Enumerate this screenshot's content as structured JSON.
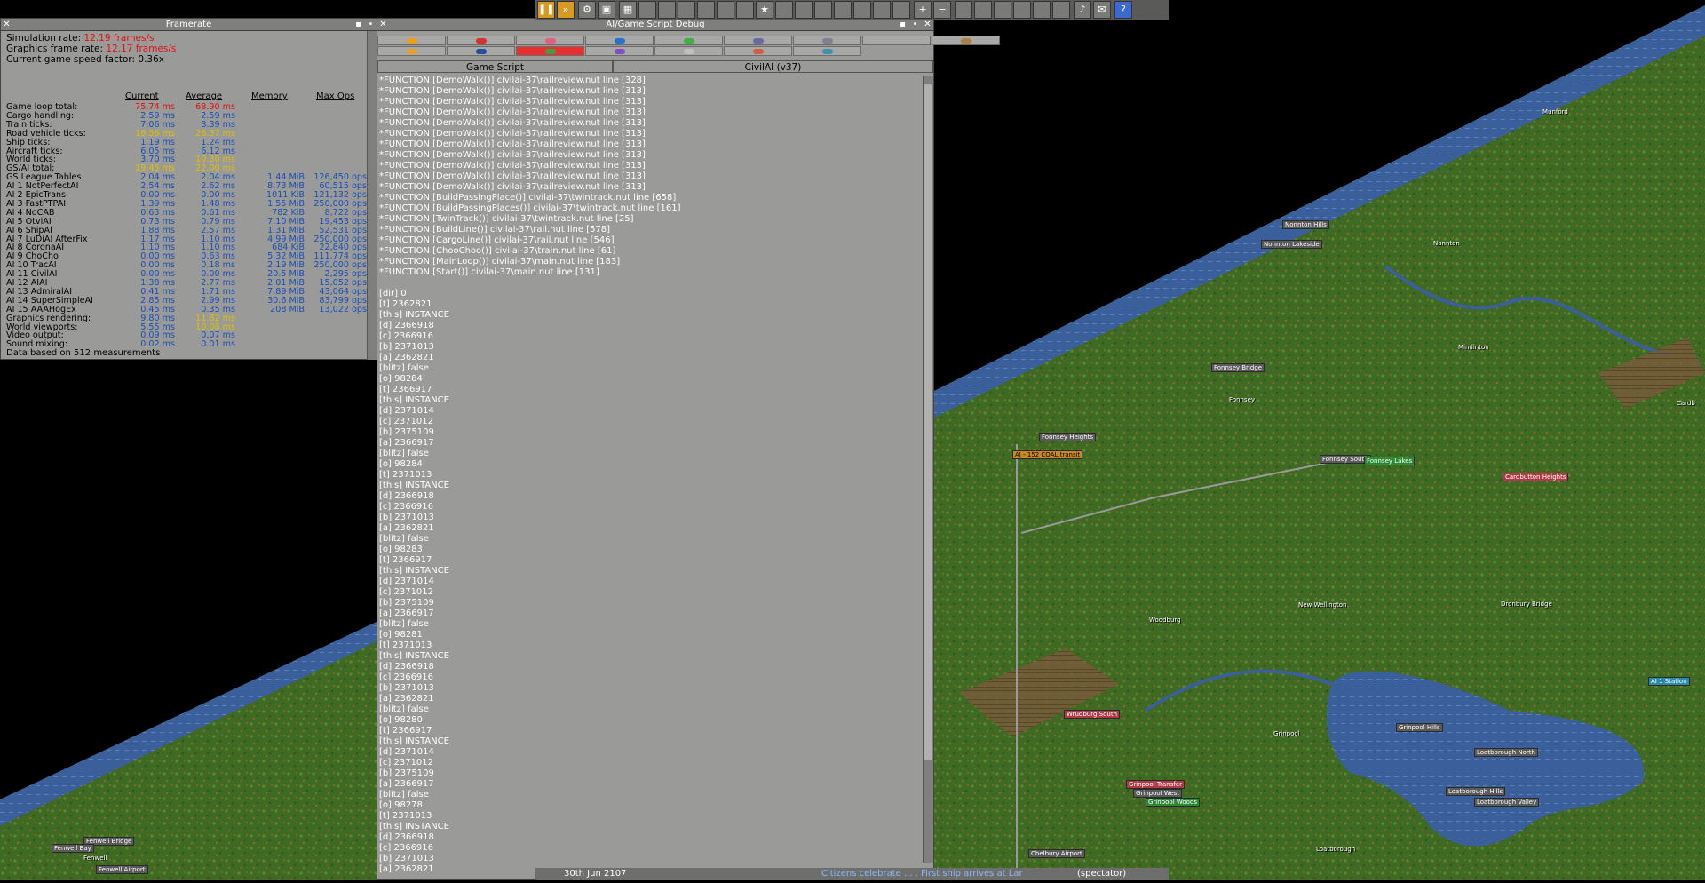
{
  "framerate": {
    "title": "Framerate",
    "sim_rate_label": "Simulation rate: ",
    "sim_rate_value": "12.19 frames/s",
    "gfx_rate_label": "Graphics frame rate: ",
    "gfx_rate_value": "12.17 frames/s",
    "speed_factor": "Current game speed factor: 0.36x",
    "headers": [
      "Current",
      "Average",
      "Memory",
      "Max Ops"
    ],
    "rows": [
      {
        "label": "Game loop total:",
        "cur": "75.74 ms",
        "avg": "68.90 ms",
        "mem": "",
        "ops": "",
        "level": "bad"
      },
      {
        "label": " Cargo handling:",
        "cur": "2.59 ms",
        "avg": "2.59 ms",
        "mem": "",
        "ops": "",
        "level": ""
      },
      {
        "label": " Train ticks:",
        "cur": "7.06 ms",
        "avg": "8.39 ms",
        "mem": "",
        "ops": "",
        "level": ""
      },
      {
        "label": " Road vehicle ticks:",
        "cur": "18.56 ms",
        "avg": "26.37 ms",
        "mem": "",
        "ops": "",
        "level": "warn"
      },
      {
        "label": " Ship ticks:",
        "cur": "1.19 ms",
        "avg": "1.24 ms",
        "mem": "",
        "ops": "",
        "level": ""
      },
      {
        "label": " Aircraft ticks:",
        "cur": "6.05 ms",
        "avg": "6.12 ms",
        "mem": "",
        "ops": "",
        "level": ""
      },
      {
        "label": " World ticks:",
        "cur": "3.70 ms",
        "avg": "10.30 ms",
        "mem": "",
        "ops": "",
        "level": "warnavg"
      },
      {
        "label": " GS/AI total:",
        "cur": "19.45 ms",
        "avg": "22.00 ms",
        "mem": "",
        "ops": "",
        "level": "warn"
      },
      {
        "label": "  GS League Tables",
        "cur": "2.04 ms",
        "avg": "2.04 ms",
        "mem": "1.44 MiB",
        "ops": "126,450 ops",
        "level": ""
      },
      {
        "label": "  AI 1 NotPerfectAI",
        "cur": "2.54 ms",
        "avg": "2.62 ms",
        "mem": "8.73 MiB",
        "ops": "60,515 ops",
        "level": ""
      },
      {
        "label": "  AI 2 EpicTrans",
        "cur": "0.00 ms",
        "avg": "0.00 ms",
        "mem": "1011 KiB",
        "ops": "121,132 ops",
        "level": ""
      },
      {
        "label": "  AI 3 FastPTPAI",
        "cur": "1.39 ms",
        "avg": "1.48 ms",
        "mem": "1.55 MiB",
        "ops": "250,000 ops",
        "level": ""
      },
      {
        "label": "  AI 4 NoCAB",
        "cur": "0.63 ms",
        "avg": "0.61 ms",
        "mem": "782 KiB",
        "ops": "8,722 ops",
        "level": ""
      },
      {
        "label": "  AI 5 OtviAI",
        "cur": "0.73 ms",
        "avg": "0.79 ms",
        "mem": "7.10 MiB",
        "ops": "19,453 ops",
        "level": ""
      },
      {
        "label": "  AI 6 ShipAI",
        "cur": "1.88 ms",
        "avg": "2.57 ms",
        "mem": "1.31 MiB",
        "ops": "52,531 ops",
        "level": ""
      },
      {
        "label": "  AI 7 LuDiAI AfterFix",
        "cur": "1.17 ms",
        "avg": "1.10 ms",
        "mem": "4.99 MiB",
        "ops": "250,000 ops",
        "level": ""
      },
      {
        "label": "  AI 8 CoronaAI",
        "cur": "1.10 ms",
        "avg": "1.10 ms",
        "mem": "684 KiB",
        "ops": "22,840 ops",
        "level": ""
      },
      {
        "label": "  AI 9 ChoCho",
        "cur": "0.00 ms",
        "avg": "0.63 ms",
        "mem": "5.32 MiB",
        "ops": "111,774 ops",
        "level": ""
      },
      {
        "label": "  AI 10 TracAI",
        "cur": "0.00 ms",
        "avg": "0.18 ms",
        "mem": "2.19 MiB",
        "ops": "250,000 ops",
        "level": ""
      },
      {
        "label": "  AI 11 CivilAI",
        "cur": "0.00 ms",
        "avg": "0.00 ms",
        "mem": "20.5 MiB",
        "ops": "2,295 ops",
        "level": ""
      },
      {
        "label": "  AI 12 AIAI",
        "cur": "1.38 ms",
        "avg": "2.77 ms",
        "mem": "2.01 MiB",
        "ops": "15,052 ops",
        "level": ""
      },
      {
        "label": "  AI 13 AdmiralAI",
        "cur": "0.41 ms",
        "avg": "1.71 ms",
        "mem": "7.89 MiB",
        "ops": "43,064 ops",
        "level": ""
      },
      {
        "label": "  AI 14 SuperSimpleAI",
        "cur": "2.85 ms",
        "avg": "2.99 ms",
        "mem": "30.6 MiB",
        "ops": "83,799 ops",
        "level": ""
      },
      {
        "label": "  AI 15 AAAHogEx",
        "cur": "0.45 ms",
        "avg": "0.35 ms",
        "mem": "208 MiB",
        "ops": "13,022 ops",
        "level": ""
      },
      {
        "label": "Graphics rendering:",
        "cur": "9.80 ms",
        "avg": "11.82 ms",
        "mem": "",
        "ops": "",
        "level": "warnavg"
      },
      {
        "label": " World viewports:",
        "cur": "5.55 ms",
        "avg": "10.08 ms",
        "mem": "",
        "ops": "",
        "level": "warnavg"
      },
      {
        "label": "Video output:",
        "cur": "0.09 ms",
        "avg": "0.07 ms",
        "mem": "",
        "ops": "",
        "level": ""
      },
      {
        "label": "Sound mixing:",
        "cur": "0.02 ms",
        "avg": "0.01 ms",
        "mem": "",
        "ops": "",
        "level": ""
      }
    ],
    "footer": "Data based on 512 measurements"
  },
  "debug": {
    "title": "AI/Game Script Debug",
    "tab_gs": "Game Script",
    "tab_ai": "CivilAI (v37)",
    "ai_colors_row1": [
      "#e8a020",
      "#d83030",
      "#e06080",
      "#2870d0",
      "#40b040",
      "#6a6aa0",
      "#808090",
      "",
      "#b08040"
    ],
    "ai_colors_row2": [
      "#e8a020",
      "#2050a0",
      "#40a040",
      "#8050c0",
      "#c0c0c0",
      "#d06040",
      "#4090b0"
    ],
    "log": [
      "*FUNCTION [DemoWalk()] civilai-37\\railreview.nut line [328]",
      "*FUNCTION [DemoWalk()] civilai-37\\railreview.nut line [313]",
      "*FUNCTION [DemoWalk()] civilai-37\\railreview.nut line [313]",
      "*FUNCTION [DemoWalk()] civilai-37\\railreview.nut line [313]",
      "*FUNCTION [DemoWalk()] civilai-37\\railreview.nut line [313]",
      "*FUNCTION [DemoWalk()] civilai-37\\railreview.nut line [313]",
      "*FUNCTION [DemoWalk()] civilai-37\\railreview.nut line [313]",
      "*FUNCTION [DemoWalk()] civilai-37\\railreview.nut line [313]",
      "*FUNCTION [DemoWalk()] civilai-37\\railreview.nut line [313]",
      "*FUNCTION [DemoWalk()] civilai-37\\railreview.nut line [313]",
      "*FUNCTION [DemoWalk()] civilai-37\\railreview.nut line [313]",
      "*FUNCTION [BuildPassingPlace()] civilai-37\\twintrack.nut line [658]",
      "*FUNCTION [BuildPassingPlaces()] civilai-37\\twintrack.nut line [161]",
      "*FUNCTION [TwinTrack()] civilai-37\\twintrack.nut line [25]",
      "*FUNCTION [BuildLine()] civilai-37\\rail.nut line [578]",
      "*FUNCTION [CargoLine()] civilai-37\\rail.nut line [546]",
      "*FUNCTION [ChooChoo()] civilai-37\\train.nut line [61]",
      "*FUNCTION [MainLoop()] civilai-37\\main.nut line [183]",
      "*FUNCTION [Start()] civilai-37\\main.nut line [131]",
      "",
      "[dir] 0",
      "[t] 2362821",
      "[this] INSTANCE",
      "[d] 2366918",
      "[c] 2366916",
      "[b] 2371013",
      "[a] 2362821",
      "[blitz] false",
      "[o] 98284",
      "[t] 2366917",
      "[this] INSTANCE",
      "[d] 2371014",
      "[c] 2371012",
      "[b] 2375109",
      "[a] 2366917",
      "[blitz] false",
      "[o] 98284",
      "[t] 2371013",
      "[this] INSTANCE",
      "[d] 2366918",
      "[c] 2366916",
      "[b] 2371013",
      "[a] 2362821",
      "[blitz] false",
      "[o] 98283",
      "[t] 2366917",
      "[this] INSTANCE",
      "[d] 2371014",
      "[c] 2371012",
      "[b] 2375109",
      "[a] 2366917",
      "[blitz] false",
      "[o] 98281",
      "[t] 2371013",
      "[this] INSTANCE",
      "[d] 2366918",
      "[c] 2366916",
      "[b] 2371013",
      "[a] 2362821",
      "[blitz] false",
      "[o] 98280",
      "[t] 2366917",
      "[this] INSTANCE",
      "[d] 2371014",
      "[c] 2371012",
      "[b] 2375109",
      "[a] 2366917",
      "[blitz] false",
      "[o] 98278",
      "[t] 2371013",
      "[this] INSTANCE",
      "[d] 2366918",
      "[c] 2366916",
      "[b] 2371013",
      "[a] 2362821"
    ]
  },
  "toolbar": {
    "icons": [
      "pause-icon",
      "fast-forward-icon",
      "settings-icon",
      "save-icon",
      "map-icon",
      "town-directory-icon",
      "subsidies-icon",
      "station-list-icon",
      "finances-icon",
      "company-icon",
      "story-book-icon",
      "goals-icon",
      "graphs-icon",
      "league-table-icon",
      "industry-icon",
      "train-list-icon",
      "road-vehicle-list-icon",
      "ship-list-icon",
      "aircraft-list-icon",
      "zoom-in-icon",
      "zoom-out-icon",
      "build-rail-icon",
      "build-road-icon",
      "build-tram-icon",
      "build-water-icon",
      "build-air-icon",
      "landscaping-icon",
      "music-icon",
      "messages-icon",
      "help-icon"
    ]
  },
  "status": {
    "date": "30th Jun 2107",
    "news": "Citizens celebrate . . .  First ship arrives at Lar",
    "company": "(spectator)"
  },
  "map": {
    "towns": [
      {
        "name": "Munford",
        "cls": "plain"
      },
      {
        "name": "Nonnton Hills",
        "cls": ""
      },
      {
        "name": "Nonnton Lakeside",
        "cls": ""
      },
      {
        "name": "Nonnton",
        "cls": "plain"
      },
      {
        "name": "Mindinton",
        "cls": "plain"
      },
      {
        "name": "Fonnsey Heights",
        "cls": ""
      },
      {
        "name": "Fonnsey",
        "cls": "plain"
      },
      {
        "name": "Fonnsey Bridge",
        "cls": ""
      },
      {
        "name": "AI - 152 COAL transit",
        "cls": "orange"
      },
      {
        "name": "Fonnsey South",
        "cls": ""
      },
      {
        "name": "Fonnsey Lakes",
        "cls": "green"
      },
      {
        "name": "Cardbutton Heights",
        "cls": "red"
      },
      {
        "name": "New Wellington",
        "cls": "plain"
      },
      {
        "name": "Woodburg",
        "cls": "plain"
      },
      {
        "name": "Dronbury Bridge",
        "cls": "plain"
      },
      {
        "name": "Wrudburg South",
        "cls": "red"
      },
      {
        "name": "Grinpool Hills",
        "cls": ""
      },
      {
        "name": "Grinpool",
        "cls": "plain"
      },
      {
        "name": "Loatborough North",
        "cls": ""
      },
      {
        "name": "Grinpool Transfer",
        "cls": "red"
      },
      {
        "name": "Grinpool West",
        "cls": ""
      },
      {
        "name": "Grinpool Woods",
        "cls": "green"
      },
      {
        "name": "Loatborough Hills",
        "cls": ""
      },
      {
        "name": "Loatborough Valley",
        "cls": ""
      },
      {
        "name": "Loatborough",
        "cls": "plain"
      },
      {
        "name": "Chelbury Airport",
        "cls": ""
      },
      {
        "name": "Fenwell Bridge",
        "cls": ""
      },
      {
        "name": "Fenwell Bay",
        "cls": ""
      },
      {
        "name": "Fenwell",
        "cls": "plain"
      },
      {
        "name": "Fenwell Airport",
        "cls": ""
      },
      {
        "name": "AI 1 Station",
        "cls": "cyan"
      },
      {
        "name": "Cardb",
        "cls": "plain"
      }
    ]
  }
}
